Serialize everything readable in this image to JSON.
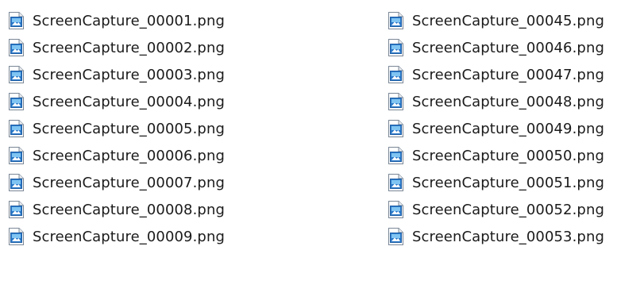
{
  "columns": [
    {
      "files": [
        {
          "name": "ScreenCapture_00001.png",
          "icon": "png-image-icon"
        },
        {
          "name": "ScreenCapture_00002.png",
          "icon": "png-image-icon"
        },
        {
          "name": "ScreenCapture_00003.png",
          "icon": "png-image-icon"
        },
        {
          "name": "ScreenCapture_00004.png",
          "icon": "png-image-icon"
        },
        {
          "name": "ScreenCapture_00005.png",
          "icon": "png-image-icon"
        },
        {
          "name": "ScreenCapture_00006.png",
          "icon": "png-image-icon"
        },
        {
          "name": "ScreenCapture_00007.png",
          "icon": "png-image-icon"
        },
        {
          "name": "ScreenCapture_00008.png",
          "icon": "png-image-icon"
        },
        {
          "name": "ScreenCapture_00009.png",
          "icon": "png-image-icon"
        }
      ]
    },
    {
      "files": [
        {
          "name": "ScreenCapture_00045.png",
          "icon": "png-image-icon"
        },
        {
          "name": "ScreenCapture_00046.png",
          "icon": "png-image-icon"
        },
        {
          "name": "ScreenCapture_00047.png",
          "icon": "png-image-icon"
        },
        {
          "name": "ScreenCapture_00048.png",
          "icon": "png-image-icon"
        },
        {
          "name": "ScreenCapture_00049.png",
          "icon": "png-image-icon"
        },
        {
          "name": "ScreenCapture_00050.png",
          "icon": "png-image-icon"
        },
        {
          "name": "ScreenCapture_00051.png",
          "icon": "png-image-icon"
        },
        {
          "name": "ScreenCapture_00052.png",
          "icon": "png-image-icon"
        },
        {
          "name": "ScreenCapture_00053.png",
          "icon": "png-image-icon"
        }
      ]
    }
  ],
  "colors": {
    "text": "#1b1b1b",
    "icon_blue": "#2b79c9",
    "icon_dark_blue": "#1f5fa6",
    "icon_sky": "#7fc4f2"
  }
}
